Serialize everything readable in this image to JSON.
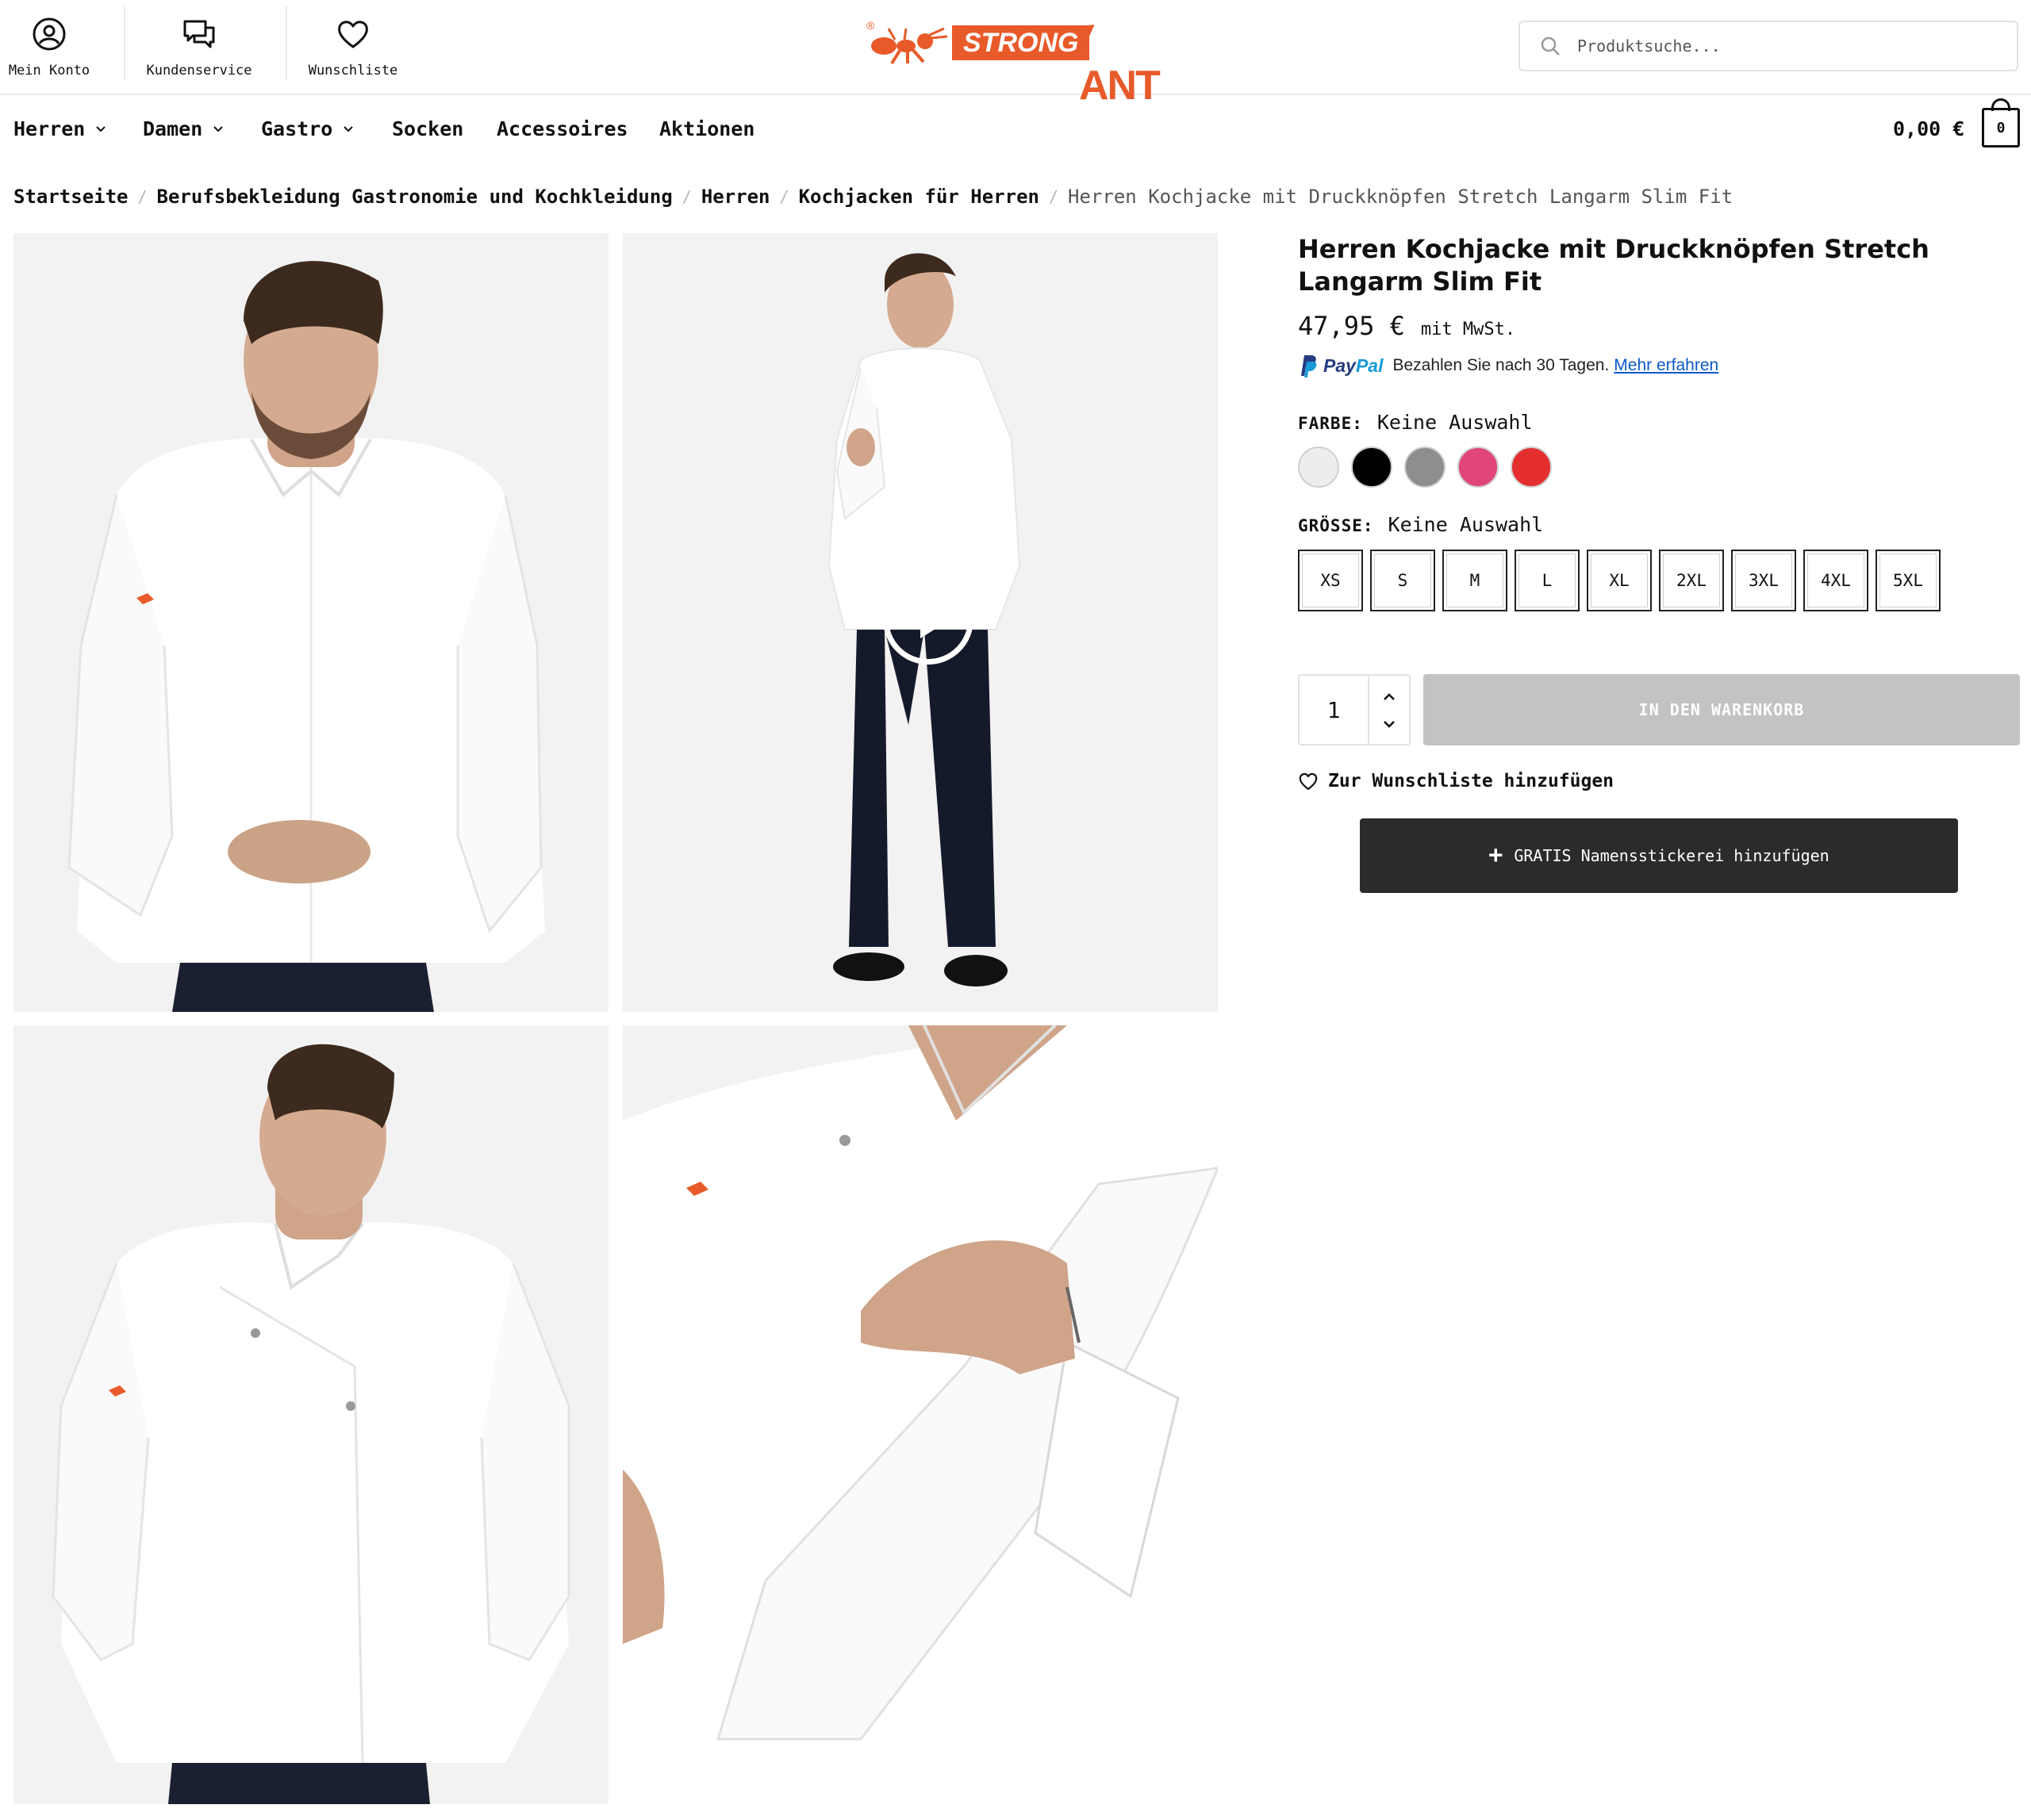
{
  "header": {
    "utility": [
      {
        "label": "Mein Konto",
        "icon": "user-circle-icon"
      },
      {
        "label": "Kundenservice",
        "icon": "chat-bubbles-icon"
      },
      {
        "label": "Wunschliste",
        "icon": "heart-icon"
      }
    ],
    "logo": {
      "registered": "®",
      "strong": "STRONG",
      "ant": "ANT"
    },
    "search": {
      "placeholder": "Produktsuche..."
    }
  },
  "nav": {
    "items": [
      {
        "label": "Herren",
        "has_dropdown": true
      },
      {
        "label": "Damen",
        "has_dropdown": true
      },
      {
        "label": "Gastro",
        "has_dropdown": true
      },
      {
        "label": "Socken",
        "has_dropdown": false
      },
      {
        "label": "Accessoires",
        "has_dropdown": false
      },
      {
        "label": "Aktionen",
        "has_dropdown": false
      }
    ],
    "cart_total": "0,00 €",
    "cart_count": "0"
  },
  "breadcrumb": {
    "items": [
      "Startseite",
      "Berufsbekleidung Gastronomie und Kochkleidung",
      "Herren",
      "Kochjacken für Herren"
    ],
    "current": "Herren Kochjacke mit Druckknöpfen Stretch Langarm Slim Fit"
  },
  "product": {
    "title": "Herren Kochjacke mit Druckknöpfen Stretch Langarm Slim Fit",
    "price": "47,95 €",
    "tax_note": "mit MwSt.",
    "paypal": {
      "pay": "Pay",
      "pal": "Pal",
      "text": "Bezahlen Sie nach 30 Tagen.",
      "link": "Mehr erfahren"
    },
    "color": {
      "label": "FARBE:",
      "value": "Keine Auswahl",
      "swatches": [
        "#ededed",
        "#000000",
        "#8e8e8e",
        "#e0457b",
        "#e52e2e"
      ]
    },
    "size": {
      "label": "GRÖSSE:",
      "value": "Keine Auswahl",
      "options": [
        "XS",
        "S",
        "M",
        "L",
        "XL",
        "2XL",
        "3XL",
        "4XL",
        "5XL"
      ]
    },
    "quantity": "1",
    "add_to_cart": "IN DEN WARENKORB",
    "wishlist": "Zur Wunschliste hinzufügen",
    "embroidery": {
      "plus": "+",
      "label": "GRATIS Namensstickerei hinzufügen"
    }
  },
  "colors": {
    "brand": "#e85a2a",
    "button_disabled": "#c3c3c3",
    "button_dark": "#2b2b2b",
    "paypal_dark": "#253b80",
    "paypal_light": "#179bd7"
  }
}
